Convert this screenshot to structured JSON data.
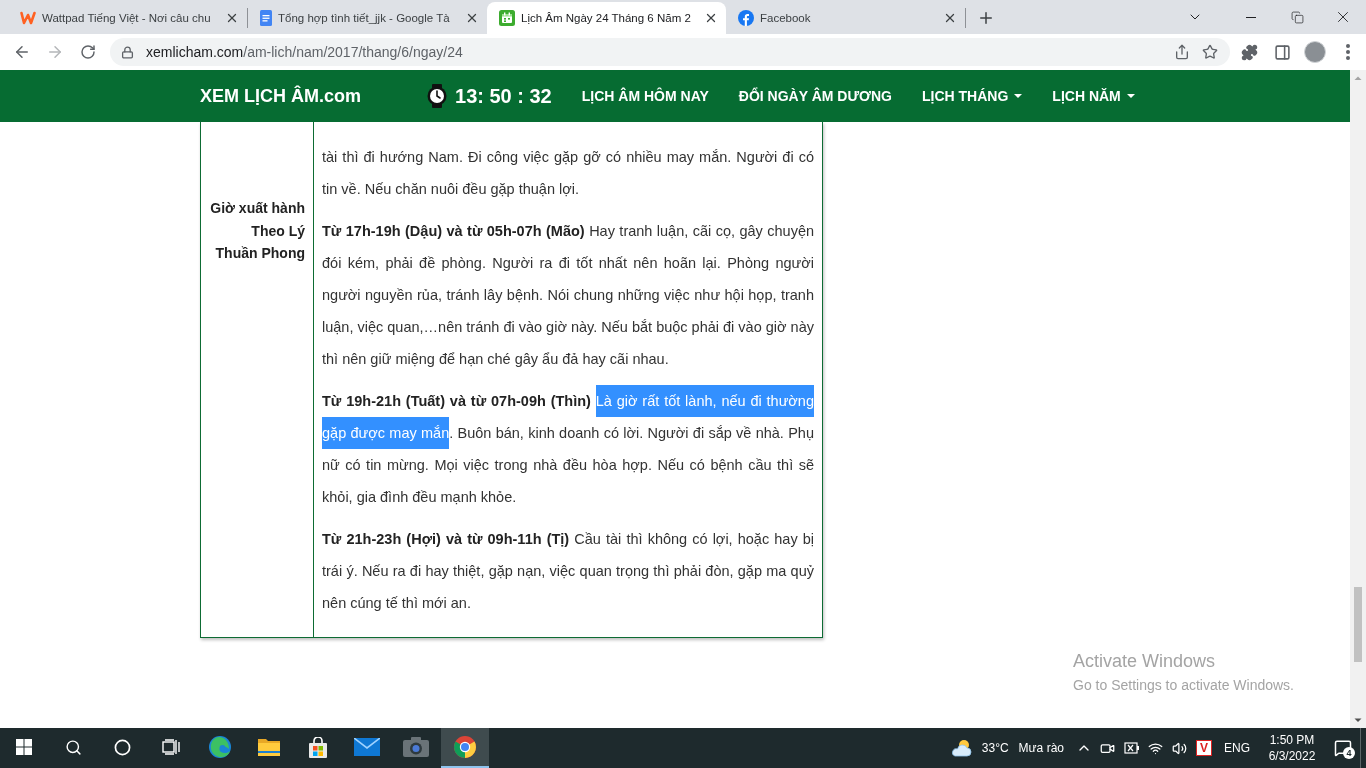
{
  "browser": {
    "tabs": [
      {
        "kind": "zigzag",
        "title": "Wattpad Tiếng Việt - Nơi câu chu",
        "selected": false
      },
      {
        "kind": "document",
        "title": "Tổng hợp tình tiết_jjk - Google Tà",
        "selected": false
      },
      {
        "kind": "calendar",
        "title": "Lịch Âm Ngày 24 Tháng 6 Năm 2",
        "selected": true
      },
      {
        "kind": "social",
        "title": "Facebook",
        "selected": false
      }
    ],
    "address": {
      "domain": "xemlicham.com",
      "path": "/am-lich/nam/2017/thang/6/ngay/24"
    }
  },
  "site": {
    "logo": "XEM LỊCH ÂM.com",
    "clock": "13: 50 : 32",
    "nav": [
      {
        "label": "LỊCH ÂM HÔM NAY",
        "dropdown": false
      },
      {
        "label": "ĐỔI NGÀY ÂM DƯƠNG",
        "dropdown": false
      },
      {
        "label": "LỊCH THÁNG",
        "dropdown": true
      },
      {
        "label": "LỊCH NĂM",
        "dropdown": true
      }
    ]
  },
  "content": {
    "label": "Giờ xuất hành Theo Lý Thuần Phong",
    "paragraphs": [
      {
        "segments": [
          {
            "text": "tài thì đi hướng Nam. Đi công việc gặp gỡ có nhiều may mắn. Người đi có tin về. Nếu chăn nuôi đều gặp thuận lợi.",
            "selected": false
          }
        ]
      },
      {
        "lead": "Từ 17h-19h (Dậu) và từ 05h-07h (Mão)",
        "segments": [
          {
            "text": "Hay tranh luận, cãi cọ, gây chuyện đói kém, phải đề phòng. Người ra đi tốt nhất nên hoãn lại. Phòng người người nguyền rủa, tránh lây bệnh. Nói chung những việc như hội họp, tranh luận, việc quan,…nên tránh đi vào giờ này. Nếu bắt buộc phải đi vào giờ này thì nên giữ miệng để hạn ché gây ẩu đả hay cãi nhau.",
            "selected": false
          }
        ]
      },
      {
        "lead": "Từ 19h-21h (Tuất) và từ 07h-09h (Thìn)",
        "segments": [
          {
            "text": "Là giờ rất tốt lành, nếu đi thường gặp được may mắn",
            "selected": true
          },
          {
            "text": ". Buôn bán, kinh doanh có lời. Người đi sắp về nhà. Phụ nữ có tin mừng. Mọi việc trong nhà đều hòa hợp. Nếu có bệnh cầu thì sẽ khỏi, gia đình đều mạnh khỏe.",
            "selected": false
          }
        ]
      },
      {
        "lead": "Từ 21h-23h (Hợi) và từ 09h-11h (Tị)",
        "segments": [
          {
            "text": "Cầu tài thì không có lợi, hoặc hay bị trái ý. Nếu ra đi hay thiệt, gặp nạn, việc quan trọng thì phải đòn, gặp ma quỷ nên cúng tế thì mới an.",
            "selected": false
          }
        ]
      }
    ]
  },
  "os_notice": {
    "title": "Activate Windows",
    "text": "Go to Settings to activate Windows."
  },
  "taskbar": {
    "apps": [
      {
        "kind": "swirl",
        "active": false
      },
      {
        "kind": "folder",
        "active": false
      },
      {
        "kind": "bag",
        "active": false
      },
      {
        "kind": "mail",
        "active": false
      },
      {
        "kind": "camera",
        "active": false
      },
      {
        "kind": "wheel",
        "active": true
      }
    ],
    "weather": {
      "temperature": "33°C",
      "condition": "Mưa rào"
    },
    "input_method": "V",
    "language": "ENG",
    "time": "1:50 PM",
    "date": "6/3/2022",
    "notifications": "4"
  }
}
